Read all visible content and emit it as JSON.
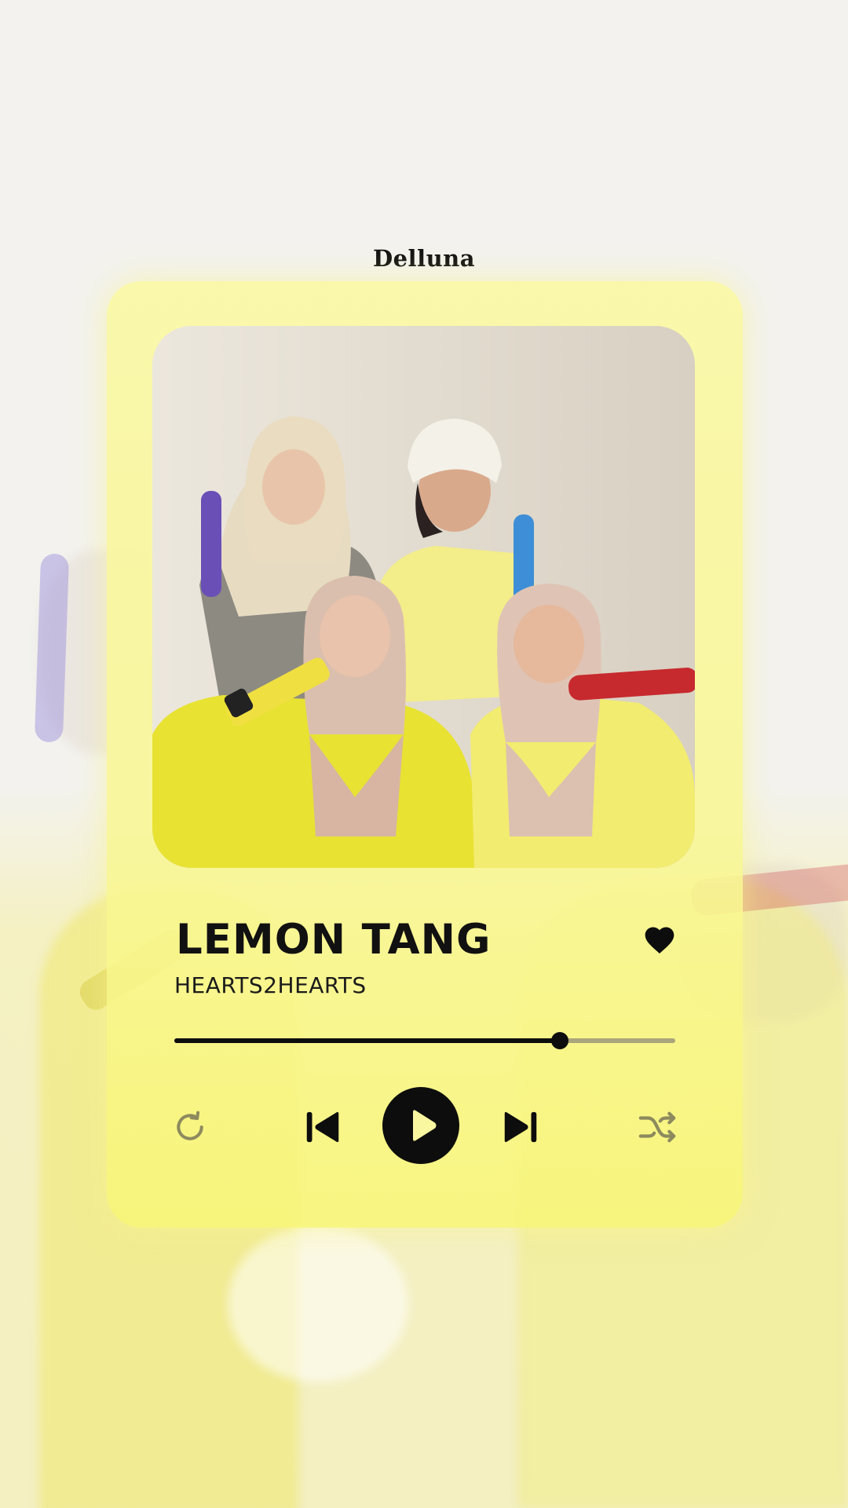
{
  "brand": "Delluna",
  "track": {
    "title": "LEMON TANG",
    "artist": "HEARTS2HEARTS",
    "liked": true,
    "progress": 0.77
  },
  "controls": {
    "repeat_icon": "repeat-icon",
    "previous_icon": "skip-previous-icon",
    "play_icon": "play-icon",
    "next_icon": "skip-next-icon",
    "shuffle_icon": "shuffle-icon"
  },
  "colors": {
    "card": "#f9f7a0",
    "accent": "#0d0d0d",
    "progress_track": "#a9a57c",
    "muted_icon": "#8d8a5e"
  }
}
